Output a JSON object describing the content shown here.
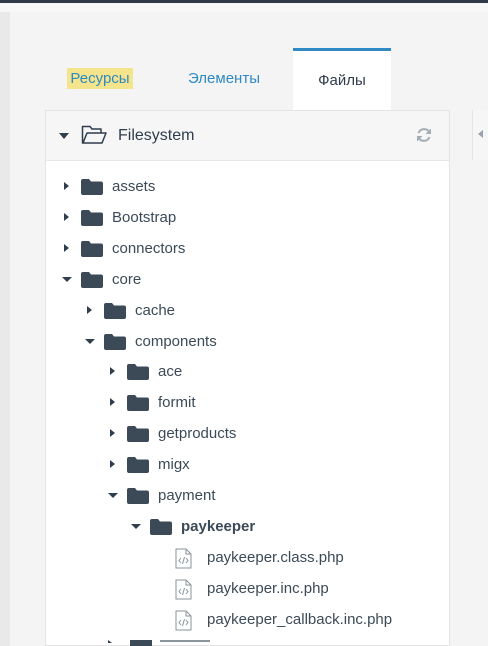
{
  "tabs": {
    "resources": "Ресурсы",
    "elements": "Элементы",
    "files": "Файлы"
  },
  "panel": {
    "title": "Filesystem"
  },
  "tree": [
    {
      "label": "assets",
      "type": "folder",
      "state": "closed",
      "depth": 0
    },
    {
      "label": "Bootstrap",
      "type": "folder",
      "state": "closed",
      "depth": 0
    },
    {
      "label": "connectors",
      "type": "folder",
      "state": "closed",
      "depth": 0
    },
    {
      "label": "core",
      "type": "folder",
      "state": "open",
      "depth": 0
    },
    {
      "label": "cache",
      "type": "folder",
      "state": "closed",
      "depth": 1
    },
    {
      "label": "components",
      "type": "folder",
      "state": "open",
      "depth": 1
    },
    {
      "label": "ace",
      "type": "folder",
      "state": "closed",
      "depth": 2
    },
    {
      "label": "formit",
      "type": "folder",
      "state": "closed",
      "depth": 2
    },
    {
      "label": "getproducts",
      "type": "folder",
      "state": "closed",
      "depth": 2
    },
    {
      "label": "migx",
      "type": "folder",
      "state": "closed",
      "depth": 2
    },
    {
      "label": "payment",
      "type": "folder",
      "state": "open",
      "depth": 2
    },
    {
      "label": "paykeeper",
      "type": "folder",
      "state": "open",
      "depth": 3,
      "selected": true
    },
    {
      "label": "paykeeper.class.php",
      "type": "file",
      "depth": 4
    },
    {
      "label": "paykeeper.inc.php",
      "type": "file",
      "depth": 4
    },
    {
      "label": "paykeeper_callback.inc.php",
      "type": "file",
      "depth": 4
    }
  ],
  "colors": {
    "accent": "#2f89c5",
    "highlight": "#f4e58c",
    "folder": "#3c4a57",
    "text": "#3c4a57"
  },
  "icons": {
    "header_folder": "folder-open-icon",
    "refresh": "refresh-icon",
    "folder": "folder-icon",
    "file": "php-file-icon"
  }
}
